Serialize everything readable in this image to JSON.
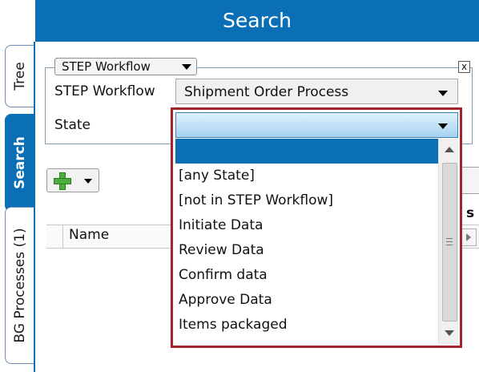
{
  "header": {
    "title": "Search"
  },
  "tabs": [
    {
      "label": "Tree",
      "active": false
    },
    {
      "label": "Search",
      "active": true
    },
    {
      "label": "BG Processes (1)",
      "active": false
    }
  ],
  "search_panel": {
    "type_selector": "STEP Workflow",
    "close_label": "x",
    "workflow": {
      "label": "STEP Workflow",
      "value": "Shipment Order Process"
    },
    "state": {
      "label": "State",
      "value": ""
    }
  },
  "state_options": [
    "",
    "[any State]",
    "[not in STEP Workflow]",
    "Initiate Data",
    "Review Data",
    "Confirm data",
    "Approve Data",
    "Items packaged"
  ],
  "grid": {
    "columns": [
      "Name"
    ],
    "partial_header_text": "s"
  },
  "icons": {
    "add": "plus-icon",
    "close": "close-icon"
  },
  "colors": {
    "accent": "#0b6fb5",
    "highlight_border": "#a3242a",
    "selection": "#0b6fb5"
  }
}
